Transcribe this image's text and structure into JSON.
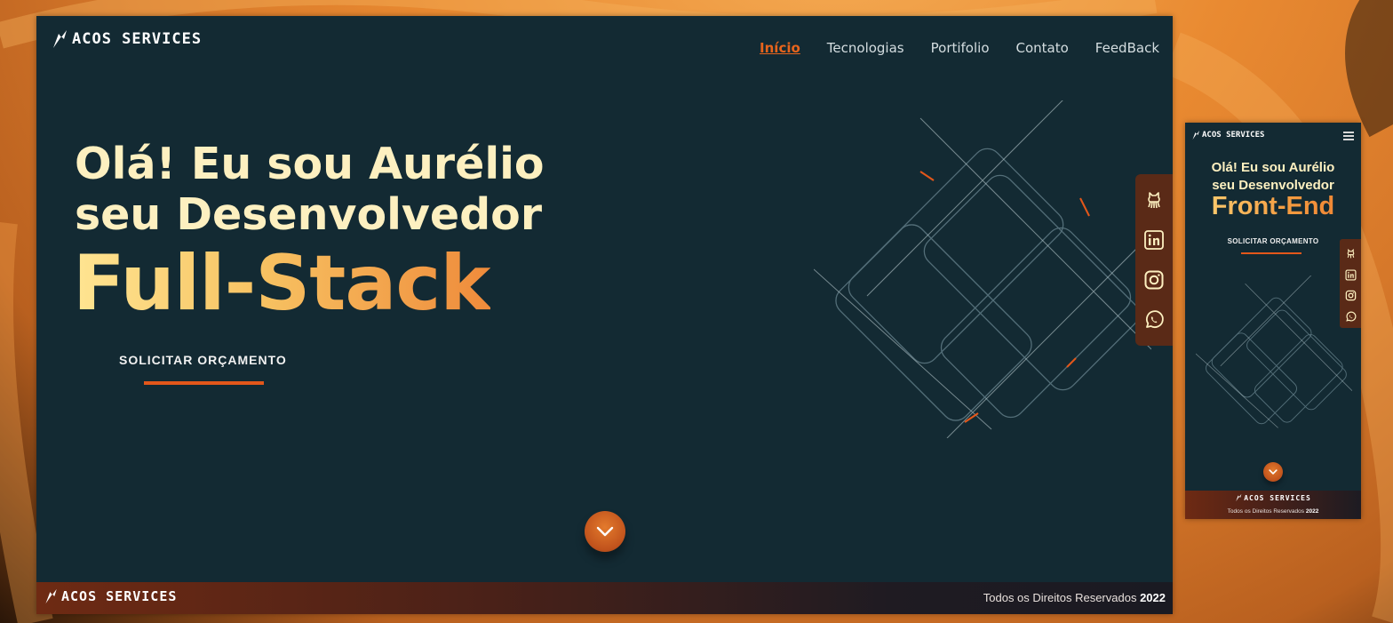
{
  "brand": {
    "name": "ACOS SERVICES"
  },
  "nav": {
    "items": [
      {
        "label": "Início",
        "active": true
      },
      {
        "label": "Tecnologias"
      },
      {
        "label": "Portifolio"
      },
      {
        "label": "Contato"
      },
      {
        "label": "FeedBack"
      }
    ]
  },
  "desktop": {
    "hero_line1": "Olá! Eu sou Aurélio",
    "hero_line2": "seu Desenvolvedor",
    "hero_role": "Full-Stack",
    "cta_label": "SOLICITAR ORÇAMENTO"
  },
  "mobile": {
    "hero_line1": "Olá! Eu sou Aurélio",
    "hero_line2": "seu Desenvolvedor",
    "hero_role": "Front-End",
    "cta_label": "SOLICITAR ORÇAMENTO"
  },
  "social": [
    "github-icon",
    "linkedin-icon",
    "instagram-icon",
    "whatsapp-icon"
  ],
  "footer": {
    "copyright": "Todos os Direitos Reservados",
    "year": "2022"
  },
  "colors": {
    "accent": "#e7641c",
    "background": "#132a33",
    "hero_text": "#fdf0c0"
  }
}
